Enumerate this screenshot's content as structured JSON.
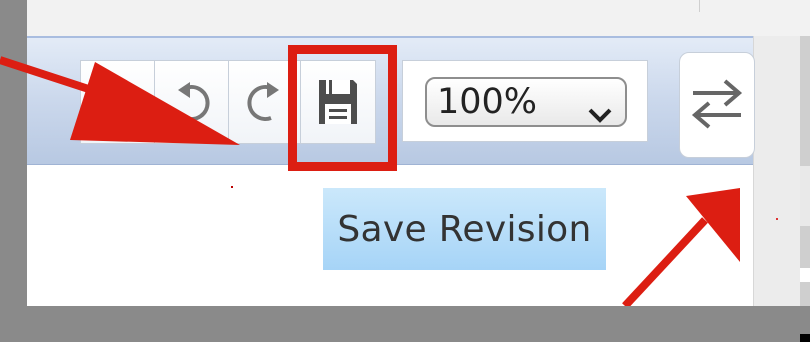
{
  "toolbar": {
    "buttons": [
      {
        "name": "first",
        "icon": "page-icon"
      },
      {
        "name": "undo",
        "icon": "undo-icon"
      },
      {
        "name": "redo",
        "icon": "redo-icon"
      },
      {
        "name": "save",
        "icon": "save-icon"
      }
    ],
    "zoom": {
      "value": "100%",
      "icon": "chevron-down-icon"
    },
    "swap_icon": "swap-arrows-icon"
  },
  "tooltip": {
    "text": "Save Revision"
  },
  "annotations": {
    "color": "#dc1e12",
    "highlight_target": "save-button",
    "arrows": [
      "arrow-to-undo",
      "arrow-to-swap"
    ]
  },
  "colors": {
    "toolbar_gradient_top": "#e3ebf7",
    "toolbar_gradient_bottom": "#b7c8e2",
    "tooltip_bg": "#a6d4f7",
    "background": "#8a8a8a"
  }
}
